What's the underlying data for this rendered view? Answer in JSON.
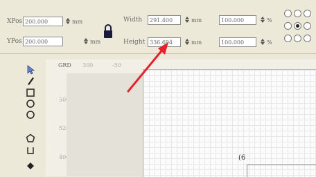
{
  "position": {
    "x_label": "XPos",
    "x_value": "200.000",
    "x_unit": "mm",
    "y_label": "YPos",
    "y_value": "200.000",
    "y_unit": "mm"
  },
  "size": {
    "width_label": "Width",
    "width_value": "291.400",
    "width_unit": "mm",
    "height_label": "Height",
    "height_value": "336.694",
    "height_unit": "mm"
  },
  "scale": {
    "width_pct": "100.000",
    "height_pct": "100.000",
    "unit": "%"
  },
  "anchor": {
    "selected": "middle-center"
  },
  "ruler": {
    "corner": "GRD",
    "top_ticks": [
      "300",
      "-50"
    ],
    "left_ticks": [
      "500",
      "520",
      "400"
    ]
  },
  "canvas": {
    "glyph": "(6"
  },
  "tools": [
    "select-icon",
    "pen-icon",
    "rectangle-icon",
    "ellipse-icon",
    "circle-icon",
    "polygon-icon",
    "text-icon",
    "fill-icon"
  ],
  "colors": {
    "annotation_arrow": "#e8202a"
  }
}
